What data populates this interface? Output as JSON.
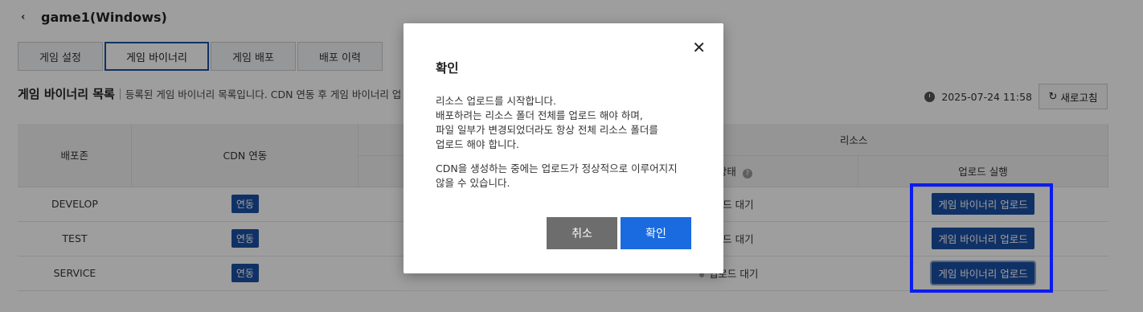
{
  "page": {
    "back_icon": "‹",
    "title": "game1(Windows)"
  },
  "tabs": [
    {
      "label": "게임 설정"
    },
    {
      "label": "게임 바이너리"
    },
    {
      "label": "게임 배포"
    },
    {
      "label": "배포 이력"
    }
  ],
  "section": {
    "title": "게임 바이너리 목록",
    "description": "등록된 게임 바이너리 목록입니다. CDN 연동 후 게임 바이너리 업"
  },
  "refresh": {
    "timestamp": "2025-07-24 11:58",
    "button_label": "새로고침",
    "refresh_icon": "↻"
  },
  "table": {
    "headers": {
      "zone": "배포존",
      "cdn": "CDN 연동",
      "resource_group": "리소스",
      "status": "드 상태",
      "upload_run": "업로드 실행"
    },
    "rows": [
      {
        "zone": "DEVELOP",
        "cdn": "연동",
        "status": "로드 대기",
        "upload": "게임 바이너리 업로드"
      },
      {
        "zone": "TEST",
        "cdn": "연동",
        "status": "로드 대기",
        "upload": "게임 바이너리 업로드"
      },
      {
        "zone": "SERVICE",
        "cdn": "연동",
        "status": "업로드 대기",
        "upload": "게임 바이너리 업로드"
      }
    ]
  },
  "modal": {
    "close_icon": "✕",
    "title": "확인",
    "paragraph1": "리소스 업로드를 시작합니다.\n배포하려는 리소스 폴더 전체를 업로드 해야 하며,\n파일 일부가 변경되었더라도 항상 전체 리소스 폴더를\n업로드 해야 합니다.",
    "paragraph2": "CDN을 생성하는 중에는 업로드가 정상적으로 이루어지지\n않을 수 있습니다.",
    "cancel_label": "취소",
    "confirm_label": "확인"
  },
  "colors": {
    "primary": "#1a4fa3",
    "confirm": "#1a6be0",
    "cancel": "#6d6d6d",
    "highlight": "#0b1cf0"
  }
}
